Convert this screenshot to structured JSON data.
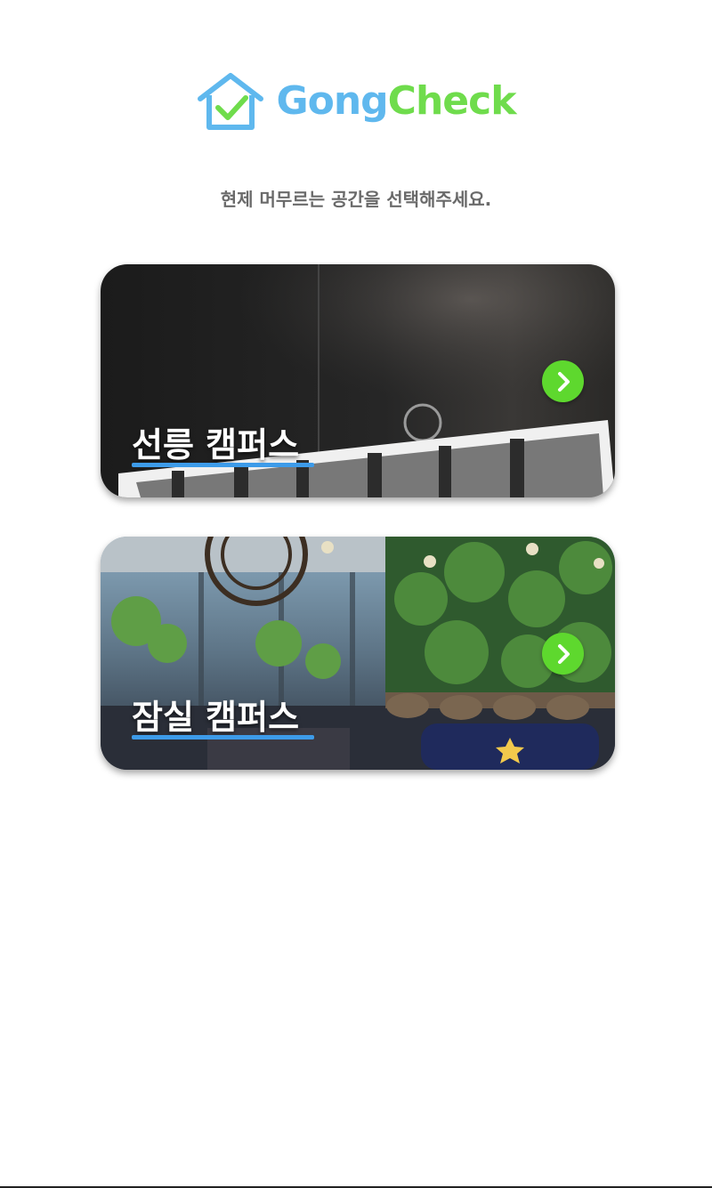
{
  "logo": {
    "text_part1": "Gong",
    "text_part2": "Check",
    "icon": "house-check-icon",
    "colors": {
      "primary": "#5fb8ee",
      "accent": "#6fdc4c"
    }
  },
  "subtitle": "현제 머무르는 공간을 선택해주세요.",
  "campuses": [
    {
      "name": "선릉 캠퍼스",
      "arrow_icon": "chevron-right-icon"
    },
    {
      "name": "잠실 캠퍼스",
      "arrow_icon": "chevron-right-icon"
    }
  ],
  "colors": {
    "underline": "#3d9be9",
    "arrow_bg": "#5ed82e"
  }
}
